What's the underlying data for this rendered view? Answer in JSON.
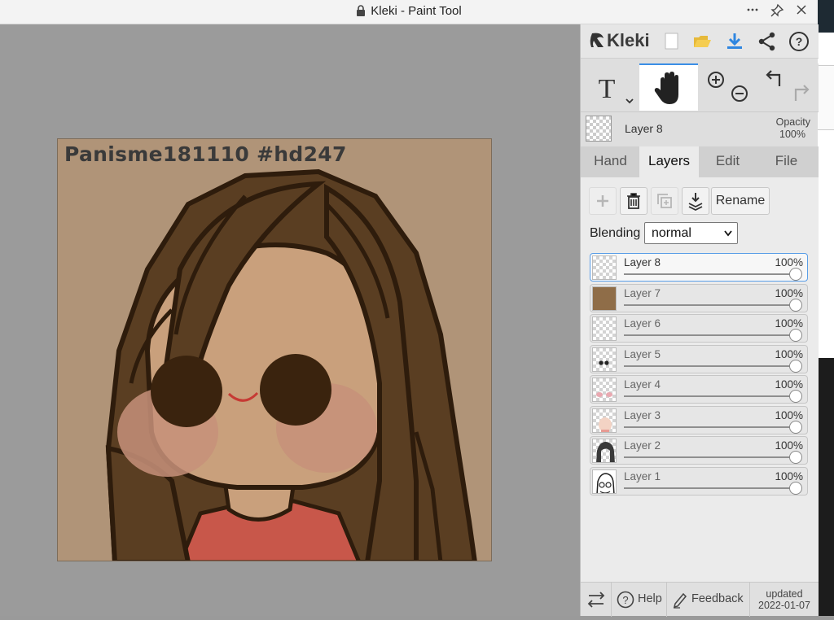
{
  "window": {
    "title": "Kleki - Paint Tool",
    "controls": [
      "more-icon",
      "pin-icon",
      "close-icon"
    ]
  },
  "artwork": {
    "overlay_text": "Panisme181110 #hd247",
    "background_color": "#b09478"
  },
  "app": {
    "logo_text": "Kleki",
    "top_icons": [
      "new-image-icon",
      "open-folder-icon",
      "download-icon",
      "share-icon",
      "help-circle-icon"
    ],
    "tools": [
      "text-tool",
      "hand-tool",
      "zoom-in-out",
      "undo-redo"
    ],
    "active_tool": "hand-tool"
  },
  "current_layer": {
    "name": "Layer 8",
    "opacity_label": "Opacity",
    "opacity_value": "100%"
  },
  "tabs": [
    {
      "label": "Hand",
      "active": false
    },
    {
      "label": "Layers",
      "active": true
    },
    {
      "label": "Edit",
      "active": false
    },
    {
      "label": "File",
      "active": false
    }
  ],
  "layers_panel": {
    "buttons": [
      "add-layer",
      "delete-layer",
      "duplicate-layer",
      "merge-down"
    ],
    "rename_label": "Rename",
    "blending_label": "Blending",
    "blending_value": "normal",
    "layers": [
      {
        "name": "Layer 8",
        "opacity": "100%",
        "selected": true,
        "opacity_fraction": 1.0
      },
      {
        "name": "Layer 7",
        "opacity": "100%",
        "selected": false,
        "opacity_fraction": 1.0
      },
      {
        "name": "Layer 6",
        "opacity": "100%",
        "selected": false,
        "opacity_fraction": 1.0
      },
      {
        "name": "Layer 5",
        "opacity": "100%",
        "selected": false,
        "opacity_fraction": 1.0
      },
      {
        "name": "Layer 4",
        "opacity": "100%",
        "selected": false,
        "opacity_fraction": 1.0
      },
      {
        "name": "Layer 3",
        "opacity": "100%",
        "selected": false,
        "opacity_fraction": 1.0
      },
      {
        "name": "Layer 2",
        "opacity": "100%",
        "selected": false,
        "opacity_fraction": 1.0
      },
      {
        "name": "Layer 1",
        "opacity": "100%",
        "selected": false,
        "opacity_fraction": 1.0
      }
    ]
  },
  "bottom_bar": {
    "help_label": "Help",
    "feedback_label": "Feedback",
    "updated_label": "updated",
    "updated_date": "2022-01-07"
  },
  "colors": {
    "accent": "#3b8ee6",
    "hair": "#5a3e22",
    "outline": "#2e1c0c",
    "skin": "#c9a07c",
    "shirt": "#c8574a",
    "blush": "#c7917a"
  }
}
